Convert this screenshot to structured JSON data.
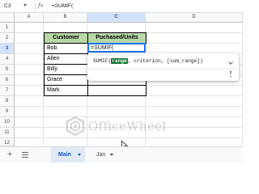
{
  "formula_bar": {
    "cell_ref": "C3",
    "fx_icon": "fx-icon",
    "content": "=SUMIF("
  },
  "columns": [
    "A",
    "B",
    "C",
    "D"
  ],
  "active_column": "C",
  "rows": [
    "1",
    "2",
    "3",
    "4",
    "5",
    "6",
    "7",
    "8",
    "9",
    "10",
    "11",
    "12"
  ],
  "active_row": "3",
  "table": {
    "headers": [
      "Customer",
      "Puchased/Units"
    ],
    "customers": [
      "Bob",
      "Allen",
      "Billy",
      "Grace",
      "Mark"
    ],
    "active_cell_value": "=SUMIF("
  },
  "formula_tooltip": {
    "function_name": "SUMIF(",
    "current_arg": "range",
    "rest": ", criterion, [sum_range])",
    "collapse_icon": "chevron-down-icon",
    "more_icon": "more-vertical-icon"
  },
  "watermark": {
    "text": "OfficeWheel",
    "logo": "officewheel-logo"
  },
  "bottom_bar": {
    "add_sheet_icon": "plus-icon",
    "all_sheets_icon": "menu-icon",
    "tabs": [
      {
        "label": "Main",
        "active": true
      },
      {
        "label": "Jan",
        "active": false
      }
    ]
  },
  "colors": {
    "accent": "#1a73e8",
    "header_fill": "#b7d7a8",
    "arg_highlight": "#137333",
    "active_tab": "#e1e9f7"
  }
}
